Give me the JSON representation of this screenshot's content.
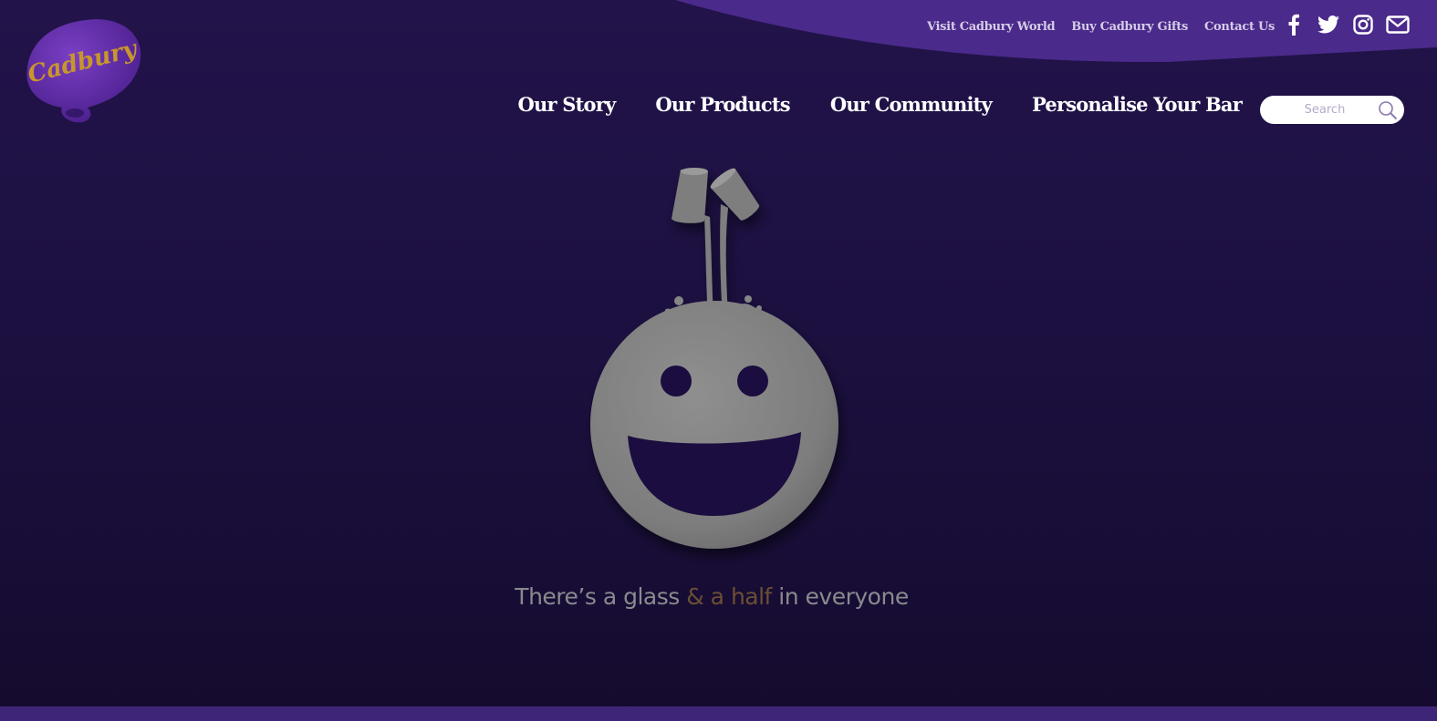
{
  "brand": {
    "logo_text": "Cadbury",
    "colors": {
      "purple": "#4b2a8c",
      "gold": "#c8962b",
      "background": "#1c1040"
    }
  },
  "utility_nav": {
    "items": [
      {
        "label": "Visit Cadbury World"
      },
      {
        "label": "Buy Cadbury Gifts"
      },
      {
        "label": "Contact Us"
      }
    ]
  },
  "social": {
    "icons": [
      "facebook-icon",
      "twitter-icon",
      "instagram-icon",
      "envelope-icon"
    ]
  },
  "main_nav": {
    "items": [
      {
        "label": "Our Story"
      },
      {
        "label": "Our Products"
      },
      {
        "label": "Our Community"
      },
      {
        "label": "Personalise Your Bar"
      }
    ]
  },
  "search": {
    "placeholder": "Search",
    "value": ""
  },
  "hero": {
    "tagline_start": "There’s a glass ",
    "tagline_accent": "& a half",
    "tagline_end": " in everyone"
  }
}
